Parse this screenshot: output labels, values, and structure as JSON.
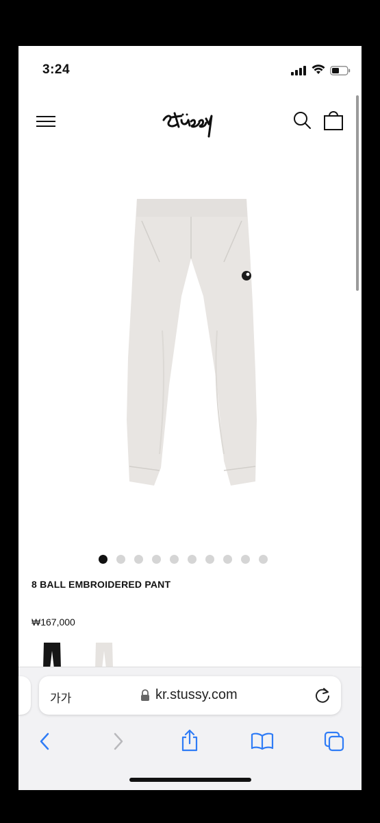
{
  "status_bar": {
    "time": "3:24",
    "signal_icon": "cellular-signal-icon",
    "wifi_icon": "wifi-icon",
    "battery_icon": "battery-icon"
  },
  "header": {
    "menu_icon": "hamburger-menu-icon",
    "logo_text": "Stüssy",
    "search_icon": "search-icon",
    "bag_icon": "shopping-bag-icon"
  },
  "product": {
    "title": "8 BALL EMBROIDERED PANT",
    "price": "₩167,000",
    "image": "light grey sweatpants with 8-ball embroidery",
    "gallery": {
      "total": 10,
      "active_index": 0
    },
    "swatches": [
      "black",
      "grey"
    ]
  },
  "browser": {
    "text_size_label": "가가",
    "url": "kr.stussy.com",
    "lock_icon": "lock-icon",
    "reload_icon": "reload-icon",
    "toolbar": [
      "back-icon",
      "forward-icon",
      "share-icon",
      "bookmarks-icon",
      "tabs-icon"
    ]
  },
  "colors": {
    "accent": "#2f7cf6",
    "text": "#111111",
    "pants": "#e8e5e2"
  }
}
